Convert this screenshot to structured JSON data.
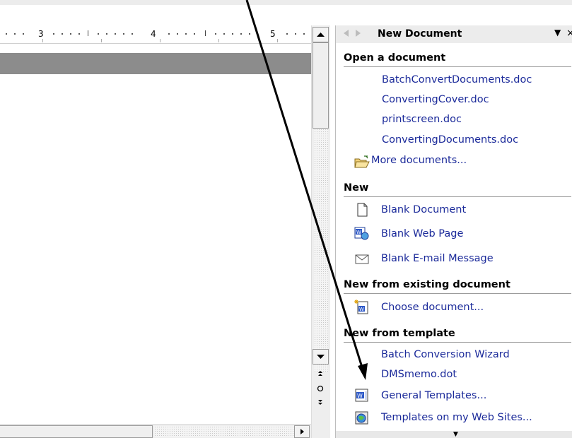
{
  "ruler": {
    "numbers": [
      "3",
      "4",
      "5"
    ]
  },
  "task_pane": {
    "title": "New Document",
    "menu_glyph": "▼",
    "close_glyph": "×",
    "sections": [
      {
        "title": "Open a document",
        "links": [
          "BatchConvertDocuments.doc",
          "ConvertingCover.doc",
          "printscreen.doc",
          "ConvertingDocuments.doc",
          "More documents..."
        ]
      },
      {
        "title": "New",
        "links": [
          "Blank Document",
          "Blank Web Page",
          "Blank E-mail Message"
        ]
      },
      {
        "title": "New from existing document",
        "links": [
          "Choose document..."
        ]
      },
      {
        "title": "New from template",
        "links": [
          "Batch Conversion Wizard",
          "DMSmemo.dot",
          "General Templates...",
          "Templates on my Web Sites..."
        ]
      }
    ]
  },
  "icons": {
    "open-folder": "open-folder-icon",
    "blank-doc": "blank-document-icon",
    "web-page": "web-page-icon",
    "email": "email-envelope-icon",
    "choose-doc": "choose-document-icon",
    "templates": "word-template-icon",
    "web-templates": "globe-template-icon"
  },
  "colors": {
    "link": "#1b2a9a",
    "pane_header": "#ececec",
    "doc_band": "#8c8c8c"
  }
}
